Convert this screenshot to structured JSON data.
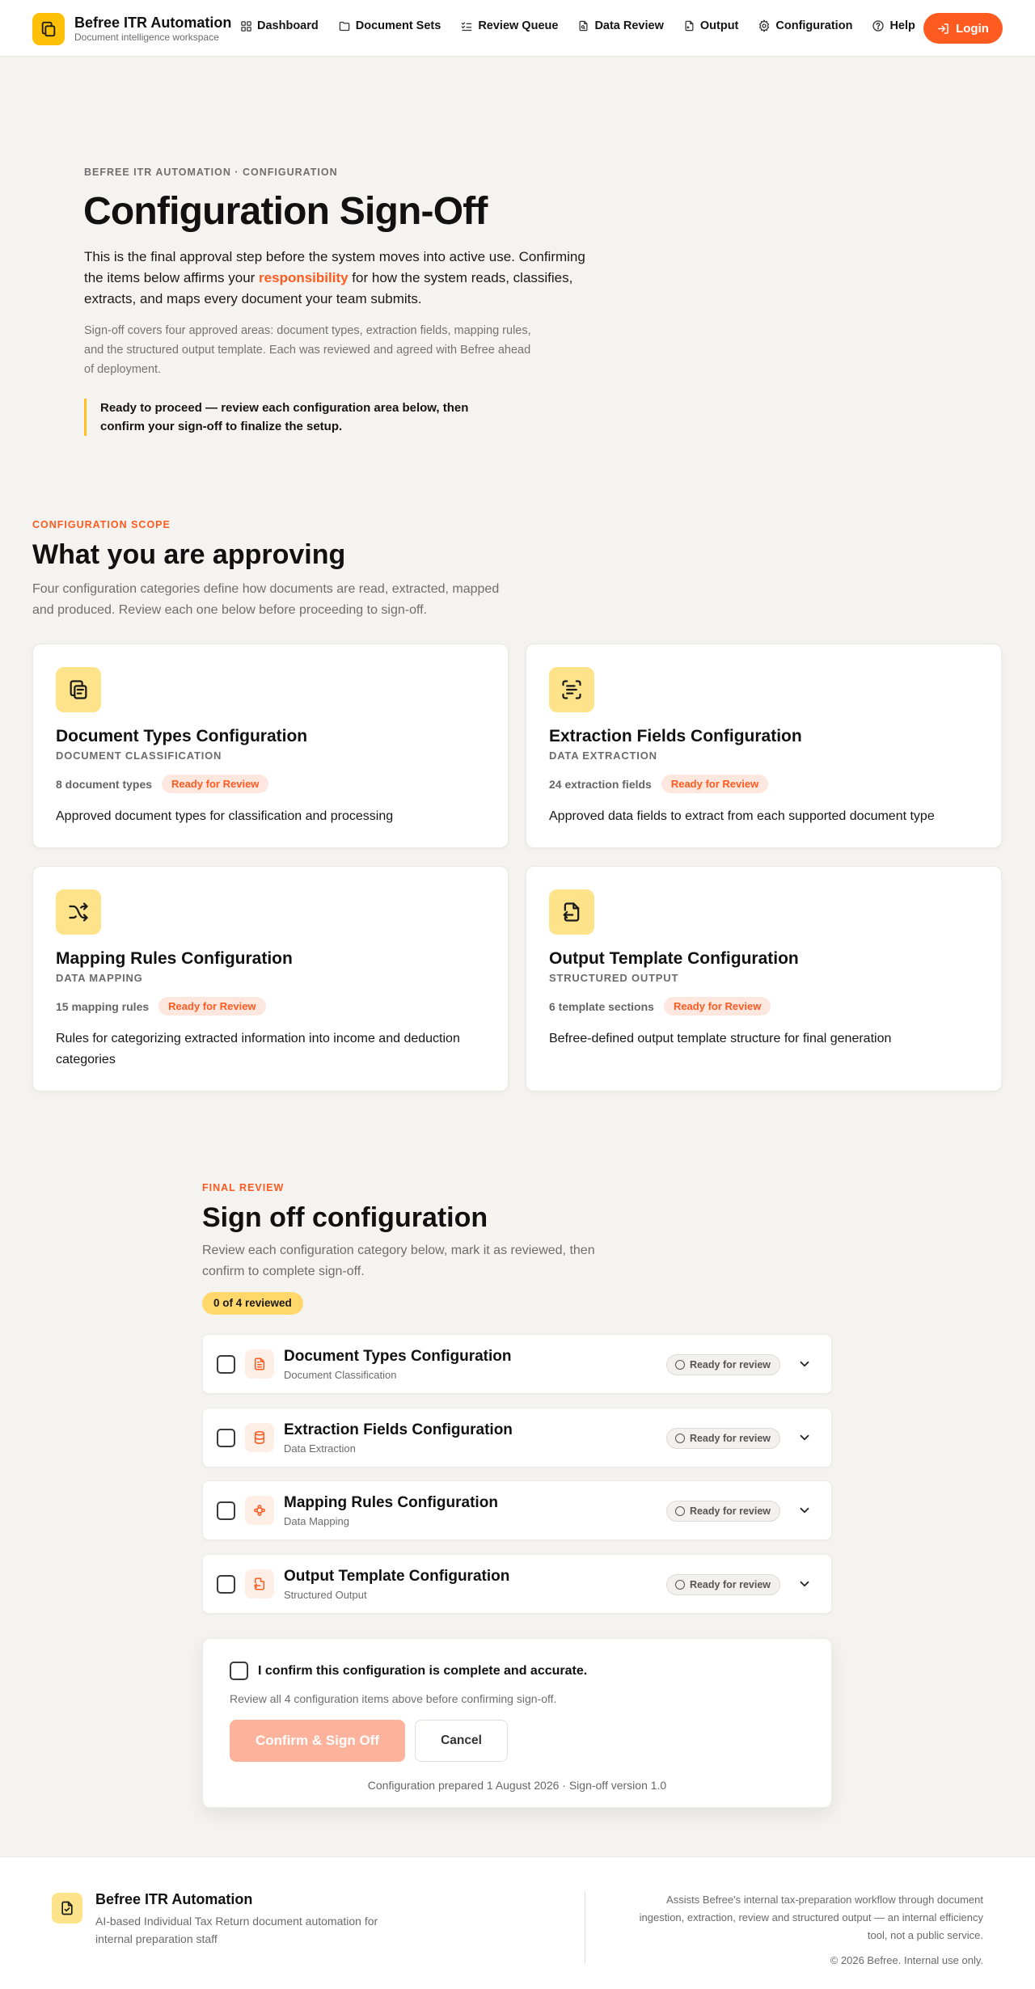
{
  "header": {
    "brand_title": "Befree ITR Automation",
    "brand_subtitle": "Document intelligence workspace",
    "nav": [
      {
        "label": "Dashboard",
        "icon": "grid-icon"
      },
      {
        "label": "Document Sets",
        "icon": "folder-icon"
      },
      {
        "label": "Review Queue",
        "icon": "checklist-icon"
      },
      {
        "label": "Data Review",
        "icon": "file-search-icon"
      },
      {
        "label": "Output",
        "icon": "file-export-icon"
      },
      {
        "label": "Configuration",
        "icon": "gear-icon"
      },
      {
        "label": "Help",
        "icon": "help-circle-icon"
      }
    ],
    "login_label": "Login"
  },
  "hero": {
    "eyebrow": "BEFREE ITR AUTOMATION · CONFIGURATION",
    "title": "Configuration Sign-Off",
    "lead_before": "This is the final approval step before the system moves into active use. Confirming the items below affirms your ",
    "lead_highlight": "responsibility",
    "lead_after": " for how the system reads, classifies, extracts, and maps every document your team submits.",
    "note": "Sign-off covers four approved areas: document types, extraction fields, mapping rules, and the structured output template. Each was reviewed and agreed with Befree ahead of deployment.",
    "callout": "Ready to proceed — review each configuration area below, then confirm your sign-off to finalize the setup."
  },
  "scope": {
    "eyebrow": "CONFIGURATION SCOPE",
    "title": "What you are approving",
    "description": "Four configuration categories define how documents are read, extracted, mapped and produced. Review each one below before proceeding to sign-off.",
    "cards": [
      {
        "title": "Document Types Configuration",
        "subtitle": "DOCUMENT CLASSIFICATION",
        "count": "8 document types",
        "status": "Ready for Review",
        "description": "Approved document types for classification and processing",
        "icon": "documents-copy-icon"
      },
      {
        "title": "Extraction Fields Configuration",
        "subtitle": "DATA EXTRACTION",
        "count": "24 extraction fields",
        "status": "Ready for Review",
        "description": "Approved data fields to extract from each supported document type",
        "icon": "scan-text-icon"
      },
      {
        "title": "Mapping Rules Configuration",
        "subtitle": "DATA MAPPING",
        "count": "15 mapping rules",
        "status": "Ready for Review",
        "description": "Rules for categorizing extracted information into income and deduction categories",
        "icon": "shuffle-icon"
      },
      {
        "title": "Output Template Configuration",
        "subtitle": "STRUCTURED OUTPUT",
        "count": "6 template sections",
        "status": "Ready for Review",
        "description": "Befree-defined output template structure for final generation",
        "icon": "file-output-icon"
      }
    ]
  },
  "review": {
    "eyebrow": "FINAL REVIEW",
    "title": "Sign off configuration",
    "description": "Review each configuration category below, mark it as reviewed, then confirm to complete sign-off.",
    "progress": "0 of 4 reviewed",
    "items": [
      {
        "title": "Document Types Configuration",
        "subtitle": "Document Classification",
        "status": "Ready for review",
        "icon": "file-text-icon"
      },
      {
        "title": "Extraction Fields Configuration",
        "subtitle": "Data Extraction",
        "status": "Ready for review",
        "icon": "database-icon"
      },
      {
        "title": "Mapping Rules Configuration",
        "subtitle": "Data Mapping",
        "status": "Ready for review",
        "icon": "workflow-icon"
      },
      {
        "title": "Output Template Configuration",
        "subtitle": "Structured Output",
        "status": "Ready for review",
        "icon": "file-output-icon"
      }
    ],
    "confirm_label": "I confirm this configuration is complete and accurate.",
    "confirm_note": "Review all 4 configuration items above before confirming sign-off.",
    "confirm_button": "Confirm & Sign Off",
    "cancel_button": "Cancel",
    "footnote": "Configuration prepared 1 August 2026 · Sign-off version 1.0"
  },
  "footer": {
    "title": "Befree ITR Automation",
    "description": "AI-based Individual Tax Return document automation for internal preparation staff",
    "right_text": "Assists Befree's internal tax-preparation workflow through document ingestion, extraction, review and structured output — an internal efficiency tool, not a public service.",
    "copyright": "© 2026 Befree. Internal use only."
  },
  "colors": {
    "accent": "#ff5a1f",
    "brand_yellow": "#ffc107",
    "icon_tile": "#ffe38a",
    "background": "#f5f3ef"
  }
}
